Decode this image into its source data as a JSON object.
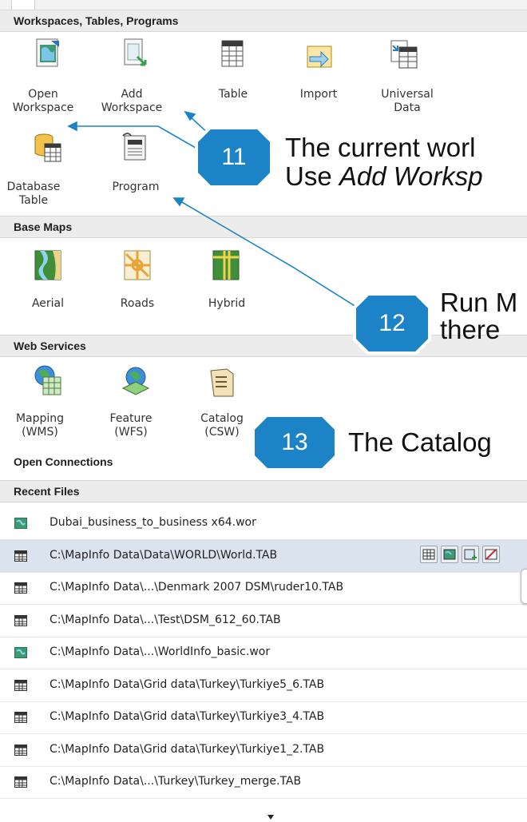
{
  "sections": {
    "workspaces": "Workspaces, Tables, Programs",
    "base_maps": "Base Maps",
    "web_services": "Web Services",
    "open_connections": "Open Connections",
    "recent_files": "Recent Files"
  },
  "workspace_items": {
    "open_workspace": "Open\nWorkspace",
    "add_workspace": "Add\nWorkspace",
    "table": "Table",
    "import": "Import",
    "universal_data": "Universal\nData",
    "database_table": "Database\nTable",
    "program": "Program"
  },
  "base_map_items": {
    "aerial": "Aerial",
    "roads": "Roads",
    "hybrid": "Hybrid"
  },
  "web_service_items": {
    "mapping": "Mapping\n(WMS)",
    "feature": "Feature\n(WFS)",
    "catalog": "Catalog\n(CSW)"
  },
  "recent_files": [
    {
      "name": "Dubai_business_to_business x64.wor",
      "icon": "workspace-file-icon"
    },
    {
      "name": "C:\\MapInfo Data\\Data\\WORLD\\World.TAB",
      "icon": "table-file-icon",
      "selected": true
    },
    {
      "name": "C:\\MapInfo Data\\...\\Denmark 2007 DSM\\ruder10.TAB",
      "icon": "table-file-icon"
    },
    {
      "name": "C:\\MapInfo Data\\...\\Test\\DSM_612_60.TAB",
      "icon": "table-file-icon"
    },
    {
      "name": "C:\\MapInfo Data\\...\\WorldInfo_basic.wor",
      "icon": "workspace-file-icon"
    },
    {
      "name": "C:\\MapInfo Data\\Grid data\\Turkey\\Turkiye5_6.TAB",
      "icon": "table-file-icon"
    },
    {
      "name": "C:\\MapInfo Data\\Grid data\\Turkey\\Turkiye3_4.TAB",
      "icon": "table-file-icon"
    },
    {
      "name": "C:\\MapInfo Data\\Grid data\\Turkey\\Turkiye1_2.TAB",
      "icon": "table-file-icon"
    },
    {
      "name": "C:\\MapInfo Data\\...\\Turkey\\Turkey_merge.TAB",
      "icon": "table-file-icon"
    }
  ],
  "callouts": {
    "c11": {
      "number": "11",
      "line1": "The current worl",
      "line2_normal": "Use ",
      "line2_italic": "Add Worksp"
    },
    "c12": {
      "number": "12",
      "line1": "Run M",
      "line2": "there"
    },
    "c13": {
      "number": "13",
      "line1": "The Catalog"
    }
  },
  "colors": {
    "badge": "#1c84c6",
    "badge_border": "#ffffff",
    "leader_line": "#1c84c6",
    "selected_row": "#dbe3ef"
  }
}
